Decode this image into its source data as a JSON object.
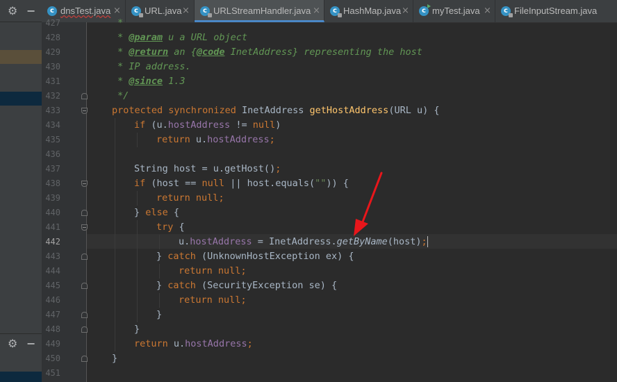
{
  "left_panel": {
    "gear_icon": "⚙",
    "hide_icon": "−",
    "accent_highlight": "#5a4f3a",
    "selection_color": "#0d293e"
  },
  "tabs": [
    {
      "label": "dnsTest.java",
      "icon": "c-class-icon",
      "error_underline": true,
      "active": false
    },
    {
      "label": "URL.java",
      "icon": "c-class-locked-icon",
      "error_underline": false,
      "active": false
    },
    {
      "label": "URLStreamHandler.java",
      "icon": "c-class-locked-icon",
      "error_underline": false,
      "active": true
    },
    {
      "label": "HashMap.java",
      "icon": "c-class-locked-icon",
      "error_underline": false,
      "active": false
    },
    {
      "label": "myTest.java",
      "icon": "c-class-runnable-icon",
      "error_underline": false,
      "active": false
    },
    {
      "label": "FileInputStream.java",
      "icon": "c-class-locked-icon",
      "error_underline": false,
      "active": false
    }
  ],
  "tab_close_glyph": "×",
  "tab_class_glyph": "c",
  "editor": {
    "current_line": "442",
    "line_numbers": [
      "427",
      "428",
      "429",
      "430",
      "431",
      "432",
      "433",
      "434",
      "435",
      "436",
      "437",
      "438",
      "439",
      "440",
      "441",
      "442",
      "443",
      "444",
      "445",
      "446",
      "447",
      "448",
      "449",
      "450",
      "451"
    ],
    "lines": [
      "*",
      "* @param u a URL object",
      "* @return an {@code InetAddress} representing the host",
      "* IP address.",
      "* @since 1.3",
      "*/",
      "protected synchronized InetAddress getHostAddress(URL u) {",
      "if (u.hostAddress != null)",
      "return u.hostAddress;",
      "",
      "String host = u.getHost();",
      "if (host == null || host.equals(\"\")) {",
      "return null;",
      "} else {",
      "try {",
      "u.hostAddress = InetAddress.getByName(host);",
      "} catch (UnknownHostException ex) {",
      "return null;",
      "} catch (SecurityException se) {",
      "return null;",
      "}",
      "}",
      "return u.hostAddress;",
      "}",
      ""
    ],
    "colors": {
      "keyword": "#cc7832",
      "comment": "#629755",
      "field": "#9876aa",
      "method": "#ffc66d",
      "string": "#6a8759",
      "text": "#a9b7c6"
    }
  },
  "annotation": {
    "type": "red-arrow",
    "color": "#e8161b",
    "points_to": "getByName"
  }
}
